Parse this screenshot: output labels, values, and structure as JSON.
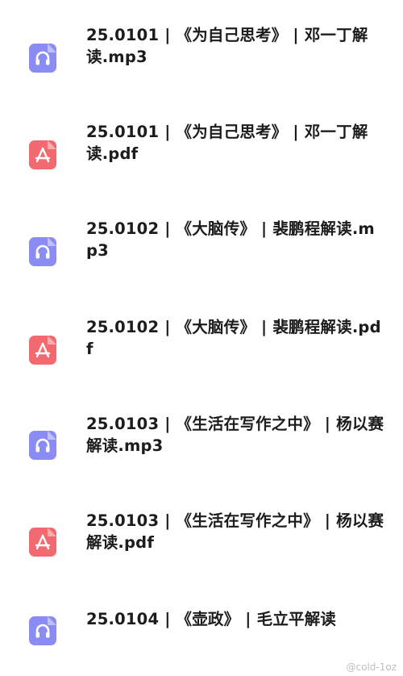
{
  "colors": {
    "audio_icon": "#8b8cf3",
    "pdf_icon": "#f26a6f",
    "text": "#1c1c1c"
  },
  "files": [
    {
      "name": "25.0101 | 《为自己思考》 | 邓一丁解读.mp3",
      "type": "audio",
      "icon": "headphones-icon"
    },
    {
      "name": "25.0101 | 《为自己思考》 | 邓一丁解读.pdf",
      "type": "pdf",
      "icon": "pdf-icon"
    },
    {
      "name": "25.0102 | 《大脑传》 | 裴鹏程解读.mp3",
      "type": "audio",
      "icon": "headphones-icon"
    },
    {
      "name": "25.0102 | 《大脑传》 | 裴鹏程解读.pdf",
      "type": "pdf",
      "icon": "pdf-icon"
    },
    {
      "name": "25.0103 | 《生活在写作之中》 | 杨以赛解读.mp3",
      "type": "audio",
      "icon": "headphones-icon"
    },
    {
      "name": "25.0103 | 《生活在写作之中》 | 杨以赛解读.pdf",
      "type": "pdf",
      "icon": "pdf-icon"
    },
    {
      "name": "25.0104 | 《壶政》 | 毛立平解读",
      "type": "audio",
      "icon": "headphones-icon"
    }
  ],
  "watermark": "@cold-1oz"
}
